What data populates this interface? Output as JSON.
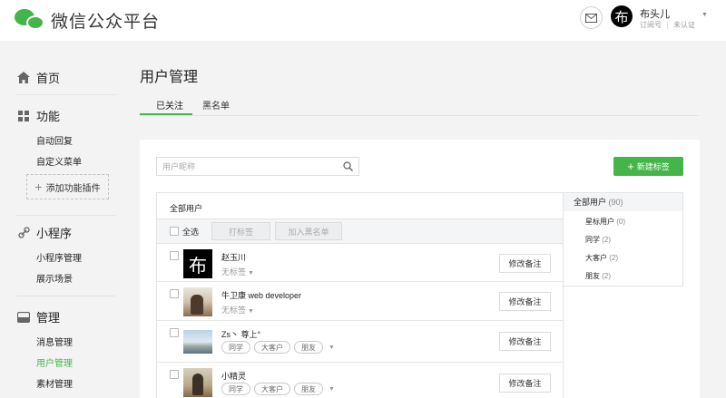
{
  "header": {
    "app_title": "微信公众平台",
    "account": {
      "avatar_char": "布",
      "name": "布头儿",
      "type": "订阅号",
      "verify": "未认证"
    }
  },
  "sidebar": {
    "sections": [
      {
        "label": "首页",
        "icon": "home-icon"
      },
      {
        "label": "功能",
        "icon": "grid-icon",
        "items": [
          "自动回复",
          "自定义菜单"
        ],
        "add_plugin": "添加功能插件"
      },
      {
        "label": "小程序",
        "icon": "link-icon",
        "items": [
          "小程序管理",
          "展示场景"
        ]
      },
      {
        "label": "管理",
        "icon": "inbox-icon",
        "items": [
          "消息管理",
          "用户管理",
          "素材管理"
        ],
        "active_item": "用户管理"
      }
    ]
  },
  "main": {
    "page_title": "用户管理",
    "tabs": [
      "已关注",
      "黑名单"
    ],
    "active_tab": "已关注",
    "search": {
      "placeholder": "用户昵称",
      "value": ""
    },
    "new_tag_button": "新建标签",
    "list_heading": "全部用户",
    "toolbar": {
      "select_all": "全选",
      "tag_button": "打标签",
      "blacklist_button": "加入黑名单"
    },
    "remark_button": "修改备注",
    "users": [
      {
        "name": "赵玉川",
        "no_tag": "无标签",
        "tags": []
      },
      {
        "name": "牛卫康 web developer",
        "no_tag": "无标签",
        "tags": []
      },
      {
        "name": "Zs丶 尊上°",
        "tags": [
          "同学",
          "大客户",
          "朋友"
        ]
      },
      {
        "name": "小精灵",
        "tags": [
          "同学",
          "大客户",
          "朋友"
        ]
      }
    ],
    "groups": {
      "all": {
        "label": "全部用户",
        "count": "(90)"
      },
      "items": [
        {
          "label": "星标用户",
          "count": "(0)"
        },
        {
          "label": "同学",
          "count": "(2)"
        },
        {
          "label": "大客户",
          "count": "(2)"
        },
        {
          "label": "朋友",
          "count": "(2)"
        }
      ]
    }
  },
  "colors": {
    "accent": "#44b549",
    "background": "#f3f3f4"
  }
}
